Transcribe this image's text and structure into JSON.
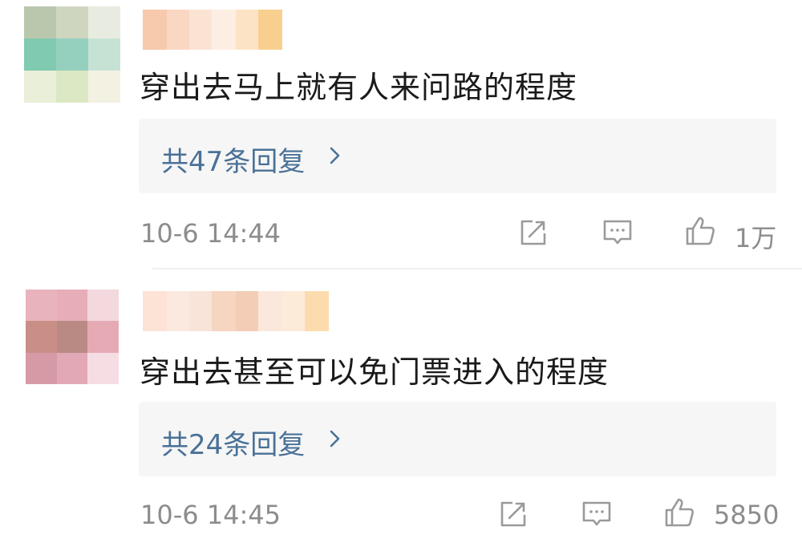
{
  "colors": {
    "reply_link": "#4a7197",
    "meta_text": "#8c8c8c",
    "reply_box_bg": "#f6f6f6",
    "content_text": "#1a1a1a"
  },
  "comments": [
    {
      "text": "穿出去马上就有人来问路的程度",
      "replies_label": "共47条回复",
      "timestamp": "10-6 14:44",
      "like_count": "1万",
      "icons": [
        "share-icon",
        "comment-icon",
        "like-icon",
        "chevron-right-icon"
      ]
    },
    {
      "text": "穿出去甚至可以免门票进入的程度",
      "replies_label": "共24条回复",
      "timestamp": "10-6 14:45",
      "like_count": "5850",
      "icons": [
        "share-icon",
        "comment-icon",
        "like-icon",
        "chevron-right-icon"
      ]
    }
  ]
}
